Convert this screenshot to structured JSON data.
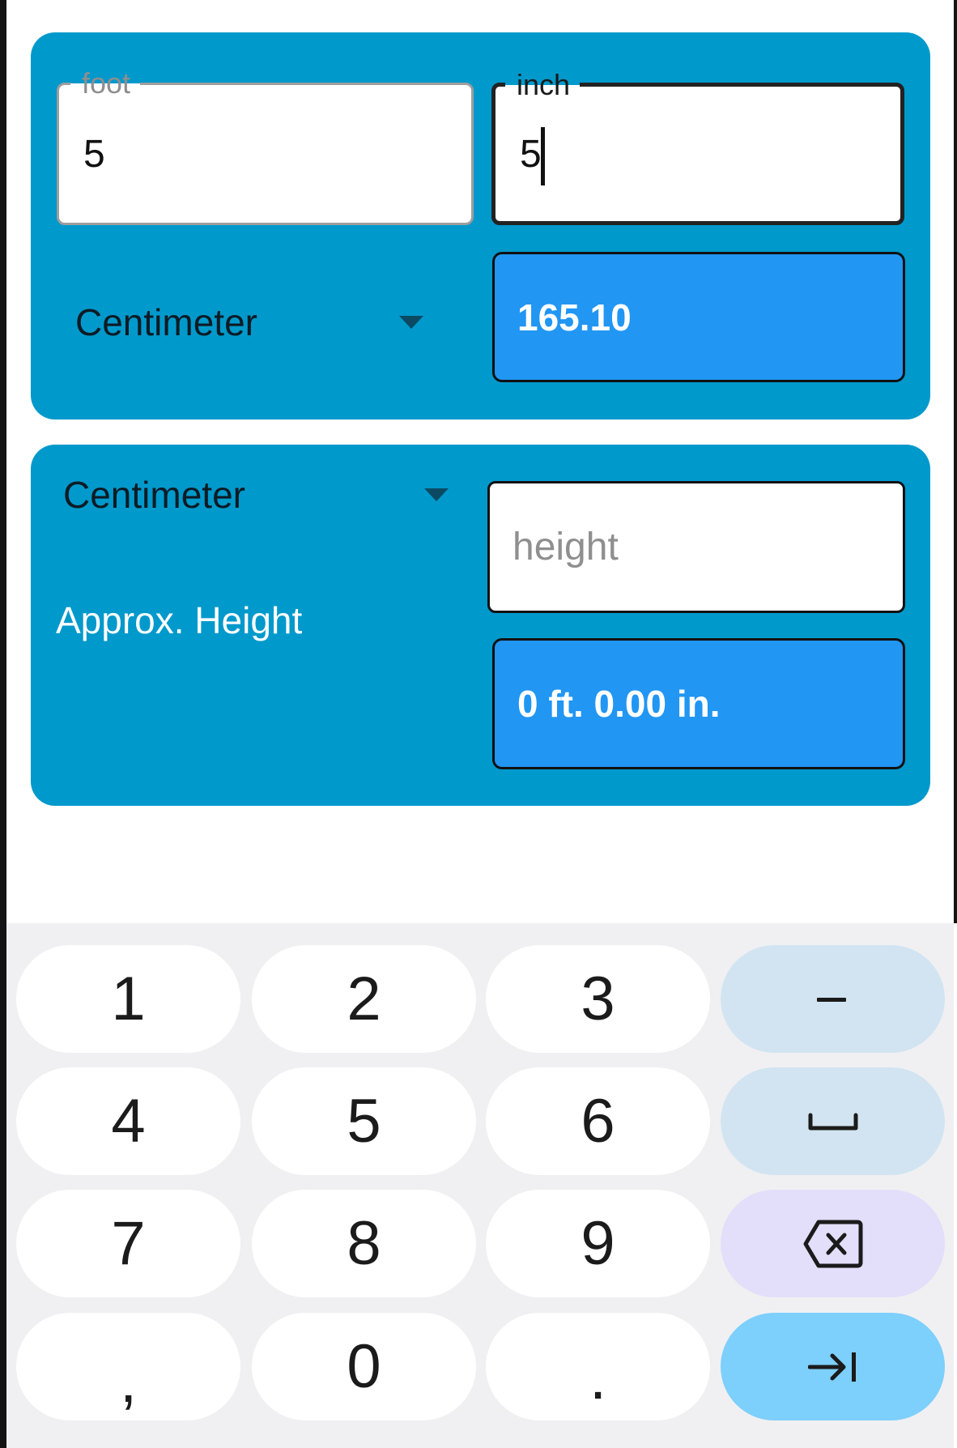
{
  "converter_to_metric": {
    "foot_field": {
      "label": "foot",
      "value": "5"
    },
    "inch_field": {
      "label": "inch",
      "value": "5"
    },
    "unit_dropdown": {
      "selected": "Centimeter"
    },
    "result": "165.10"
  },
  "converter_to_imperial": {
    "unit_dropdown": {
      "selected": "Centimeter"
    },
    "height_field": {
      "value": "",
      "placeholder": "height"
    },
    "approx_label": "Approx. Height",
    "result": "0 ft. 0.00 in."
  },
  "keyboard": {
    "rows": [
      [
        {
          "label": "1",
          "name": "key-1"
        },
        {
          "label": "2",
          "name": "key-2"
        },
        {
          "label": "3",
          "name": "key-3"
        },
        {
          "label": "–",
          "name": "key-minus"
        }
      ],
      [
        {
          "label": "4",
          "name": "key-4"
        },
        {
          "label": "5",
          "name": "key-5"
        },
        {
          "label": "6",
          "name": "key-6"
        },
        {
          "label": "space",
          "name": "key-space"
        }
      ],
      [
        {
          "label": "7",
          "name": "key-7"
        },
        {
          "label": "8",
          "name": "key-8"
        },
        {
          "label": "9",
          "name": "key-9"
        },
        {
          "label": "backspace",
          "name": "key-backspace"
        }
      ],
      [
        {
          "label": ",",
          "name": "key-comma"
        },
        {
          "label": "0",
          "name": "key-0"
        },
        {
          "label": ".",
          "name": "key-period"
        },
        {
          "label": "next",
          "name": "key-next"
        }
      ]
    ]
  },
  "colors": {
    "card": "#0099cc",
    "result_box": "#2196f3",
    "keyboard_bg": "#f0f0f2",
    "key_function": "#d2e4f2",
    "key_backspace": "#e3defa",
    "key_enter": "#7dcffc"
  }
}
